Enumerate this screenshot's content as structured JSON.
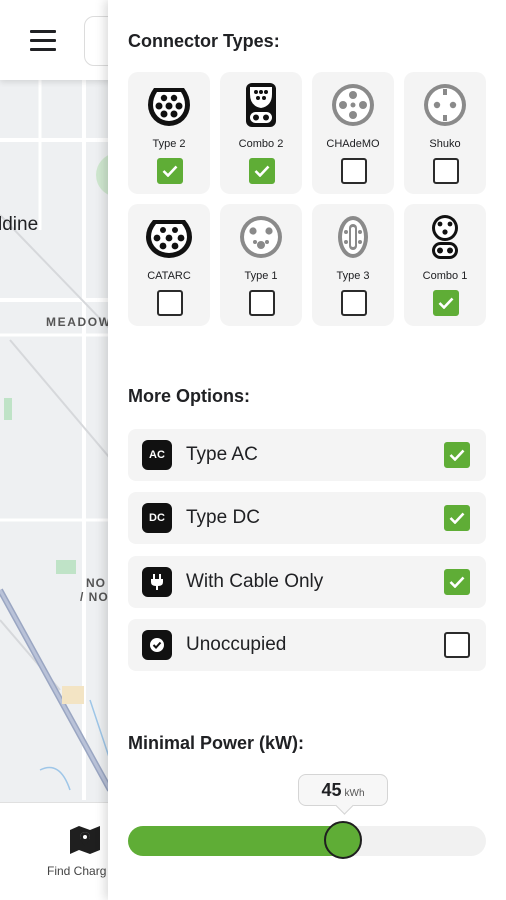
{
  "map": {
    "labels": {
      "aldine": "ldine",
      "meadow": "MEADOW",
      "no_line1": "NO",
      "no_line2": "/ NO"
    },
    "bottom_nav": {
      "find_label": "Find Charg"
    }
  },
  "filters": {
    "connector_title": "Connector Types:",
    "connectors": [
      {
        "label": "Type 2",
        "checked": true,
        "active": true
      },
      {
        "label": "Combo 2",
        "checked": true,
        "active": true
      },
      {
        "label": "CHAdeMO",
        "checked": false,
        "active": false
      },
      {
        "label": "Shuko",
        "checked": false,
        "active": false
      },
      {
        "label": "CATARC",
        "checked": false,
        "active": true
      },
      {
        "label": "Type 1",
        "checked": false,
        "active": false
      },
      {
        "label": "Type 3",
        "checked": false,
        "active": false
      },
      {
        "label": "Combo 1",
        "checked": true,
        "active": true
      }
    ],
    "more_title": "More Options:",
    "options": [
      {
        "icon_text": "AC",
        "label": "Type AC",
        "checked": true
      },
      {
        "icon_text": "DC",
        "label": "Type DC",
        "checked": true
      },
      {
        "icon_text": "plug-icon",
        "label": "With Cable Only",
        "checked": true
      },
      {
        "icon_text": "occupancy-icon",
        "label": "Unoccupied",
        "checked": false
      }
    ],
    "power_title": "Minimal Power (kW):",
    "power": {
      "value": "45",
      "unit": "kWh",
      "fraction": 0.6
    }
  },
  "colors": {
    "accent": "#5fad36",
    "tile_bg": "#f4f4f4",
    "inactive_icon": "#8a8a8a",
    "active_icon": "#111111"
  }
}
